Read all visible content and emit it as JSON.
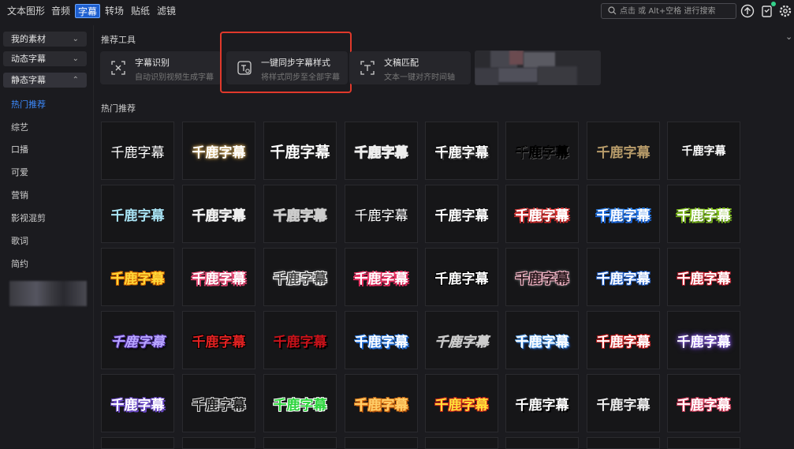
{
  "top_nav": {
    "tabs": [
      {
        "label": "文本图形",
        "active": false
      },
      {
        "label": "音频",
        "active": false
      },
      {
        "label": "字幕",
        "active": true
      },
      {
        "label": "转场",
        "active": false
      },
      {
        "label": "贴纸",
        "active": false
      },
      {
        "label": "滤镜",
        "active": false
      }
    ],
    "search_placeholder": "点击 或 Alt+空格 进行搜索",
    "icons": [
      "upload-icon",
      "notes-icon",
      "settings-icon"
    ],
    "accent_color": "#1d5fd0"
  },
  "sidebar": {
    "categories": [
      {
        "label": "我的素材",
        "expanded": false
      },
      {
        "label": "动态字幕",
        "expanded": false
      },
      {
        "label": "静态字幕",
        "expanded": true
      }
    ],
    "subcategories": [
      {
        "label": "热门推荐",
        "active": true
      },
      {
        "label": "综艺",
        "active": false
      },
      {
        "label": "口播",
        "active": false
      },
      {
        "label": "可爱",
        "active": false
      },
      {
        "label": "营销",
        "active": false
      },
      {
        "label": "影视混剪",
        "active": false
      },
      {
        "label": "歌词",
        "active": false
      },
      {
        "label": "简约",
        "active": false
      }
    ]
  },
  "tools": {
    "title": "推荐工具",
    "items": [
      {
        "name": "字幕识别",
        "desc": "自动识别视频生成字幕",
        "icon": "speech-recognition-icon",
        "highlighted": false
      },
      {
        "name": "一键同步字幕样式",
        "desc": "将样式同步至全部字幕",
        "icon": "sync-style-icon",
        "highlighted": true
      },
      {
        "name": "文稿匹配",
        "desc": "文本一键对齐时间轴",
        "icon": "text-match-icon",
        "highlighted": false
      }
    ]
  },
  "hot": {
    "title": "热门推荐",
    "presets": [
      {
        "text": "千鹿字幕",
        "style": "plain-white"
      },
      {
        "text": "千鹿字幕",
        "style": "glow-warm"
      },
      {
        "text": "千鹿字幕",
        "style": "plain-white-bold"
      },
      {
        "text": "千鹿字幕",
        "style": "outline-thin"
      },
      {
        "text": "千鹿字幕",
        "style": "white-shadow"
      },
      {
        "text": "千鹿字幕",
        "style": "white-dark-outline"
      },
      {
        "text": "千鹿字幕",
        "style": "gold-serif"
      },
      {
        "text": "千鹿字幕",
        "style": "white-small"
      },
      {
        "text": "千鹿字幕",
        "style": "light-blue"
      },
      {
        "text": "千鹿字幕",
        "style": "grey-outline"
      },
      {
        "text": "千鹿字幕",
        "style": "hollow-outline"
      },
      {
        "text": "千鹿字幕",
        "style": "serif-white"
      },
      {
        "text": "千鹿字幕",
        "style": "white-bold-2"
      },
      {
        "text": "千鹿字幕",
        "style": "red-sticker"
      },
      {
        "text": "千鹿字幕",
        "style": "blue-sticker"
      },
      {
        "text": "千鹿字幕",
        "style": "green-sticker"
      },
      {
        "text": "千鹿字幕",
        "style": "yellow-orange"
      },
      {
        "text": "千鹿字幕",
        "style": "pink-white"
      },
      {
        "text": "千鹿字幕",
        "style": "grey-white-outline"
      },
      {
        "text": "千鹿字幕",
        "style": "pink-sticker"
      },
      {
        "text": "千鹿字幕",
        "style": "white-black"
      },
      {
        "text": "千鹿字幕",
        "style": "pink-outline"
      },
      {
        "text": "千鹿字幕",
        "style": "blue-outline"
      },
      {
        "text": "千鹿字幕",
        "style": "red-outline-white"
      },
      {
        "text": "千鹿字幕",
        "style": "purple-chrome"
      },
      {
        "text": "千鹿字幕",
        "style": "red-black"
      },
      {
        "text": "千鹿字幕",
        "style": "dark-red"
      },
      {
        "text": "千鹿字幕",
        "style": "blue-3d"
      },
      {
        "text": "千鹿字幕",
        "style": "grey-italic"
      },
      {
        "text": "千鹿字幕",
        "style": "blue-white"
      },
      {
        "text": "千鹿字幕",
        "style": "red-white"
      },
      {
        "text": "千鹿字幕",
        "style": "purple-glow"
      },
      {
        "text": "千鹿字幕",
        "style": "purple-white"
      },
      {
        "text": "千鹿字幕",
        "style": "black-white-outline"
      },
      {
        "text": "千鹿字幕",
        "style": "green-bright"
      },
      {
        "text": "千鹿字幕",
        "style": "orange-puff"
      },
      {
        "text": "千鹿字幕",
        "style": "yellow-red"
      },
      {
        "text": "千鹿字幕",
        "style": "white-shadow-2"
      },
      {
        "text": "千鹿字幕",
        "style": "white-serif-2"
      },
      {
        "text": "千鹿字幕",
        "style": "red-pink"
      }
    ]
  }
}
